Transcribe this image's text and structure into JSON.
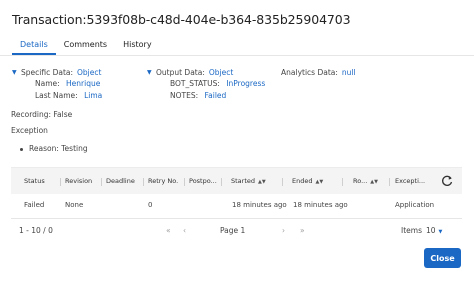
{
  "dialog": {
    "title": "Transaction:5393f08b-c48d-404e-b364-835b25904703"
  },
  "tabs": [
    {
      "label": "Details",
      "active": true
    },
    {
      "label": "Comments",
      "active": false
    },
    {
      "label": "History",
      "active": false
    }
  ],
  "specific_data": {
    "label": "Specific Data:",
    "value": "Object",
    "fields": [
      {
        "key": "Name:",
        "value": "Henrique"
      },
      {
        "key": "Last Name:",
        "value": "Lima"
      }
    ]
  },
  "output_data": {
    "label": "Output Data:",
    "value": "Object",
    "fields": [
      {
        "key": "BOT_STATUS:",
        "value": "InProgress"
      },
      {
        "key": "NOTES:",
        "value": "Failed"
      }
    ]
  },
  "analytics_data": {
    "label": "Analytics Data:",
    "value": "null"
  },
  "recording": "Recording: False",
  "exception": {
    "label": "Exception",
    "reason": "Reason: Testing"
  },
  "table": {
    "columns": [
      "Status",
      "Revision",
      "Deadline",
      "Retry No.",
      "Postpo...",
      "Started",
      "Ended",
      "Ro...",
      "Excepti..."
    ],
    "rows": [
      [
        "Failed",
        "None",
        "",
        "0",
        "",
        "18 minutes ago",
        "18 minutes ago",
        "",
        "Application"
      ]
    ]
  },
  "pagination": {
    "range": "1 - 10 / 0",
    "first": "«",
    "prev": "‹",
    "page_label": "Page 1",
    "next": "›",
    "last": "»",
    "items_label": "Items",
    "items_value": "10"
  },
  "footer": {
    "close_label": "Close"
  },
  "colors": {
    "accent": "#1b68c4",
    "header_bg": "#f4f4f5"
  }
}
